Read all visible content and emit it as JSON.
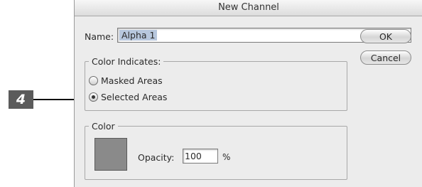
{
  "dialog": {
    "title": "New Channel",
    "name_label": "Name:",
    "name_value": "Alpha 1",
    "ok_label": "OK",
    "cancel_label": "Cancel"
  },
  "color_indicates": {
    "legend": "Color Indicates:",
    "options": [
      {
        "label": "Masked Areas",
        "selected": false
      },
      {
        "label": "Selected Areas",
        "selected": true
      }
    ]
  },
  "color": {
    "legend": "Color",
    "swatch_color": "#8a8a8a",
    "opacity_label": "Opacity:",
    "opacity_value": "100",
    "opacity_unit": "%"
  },
  "annotation": {
    "step_number": "4",
    "badge_color": "#5b5b5b",
    "arrow_icon": "right-arrow-icon"
  }
}
